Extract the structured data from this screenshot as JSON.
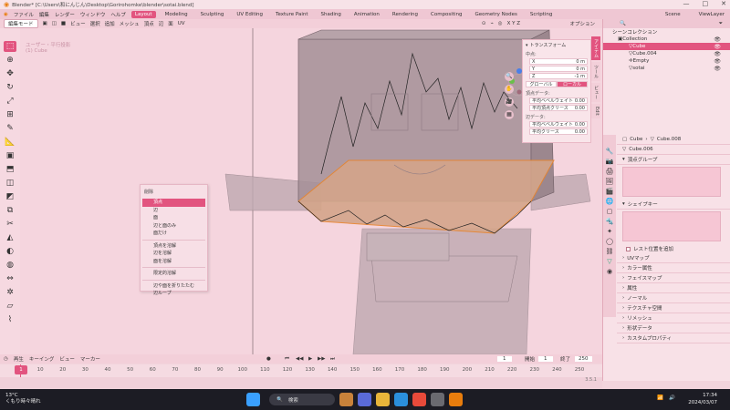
{
  "titlebar": {
    "title": "Blender* [C:\\Users\\和にんじん\\Desktop\\Gorirohomke\\blender\\sotai.blend]",
    "minimize": "—",
    "maximize": "□",
    "close": "✕"
  },
  "menubar": {
    "items": [
      "ファイル",
      "編集",
      "レンダー",
      "ウィンドウ",
      "ヘルプ"
    ],
    "workspaces": [
      "Layout",
      "Modeling",
      "Sculpting",
      "UV Editing",
      "Texture Paint",
      "Shading",
      "Animation",
      "Rendering",
      "Compositing",
      "Geometry Nodes",
      "Scripting"
    ],
    "scene": "Scene",
    "view_layer": "ViewLayer"
  },
  "viewport_header": {
    "mode": "編集モード",
    "menus": [
      "ビュー",
      "選択",
      "追加",
      "メッシュ",
      "頂点",
      "辺",
      "面",
      "UV"
    ],
    "axes": "X Y Z",
    "options": "オプション"
  },
  "viewport": {
    "view_label": "ユーザー・平行投影",
    "object_label": "(1) Cube"
  },
  "toolbar": {
    "tools": [
      "select-icon",
      "cursor-icon",
      "move-icon",
      "rotate-icon",
      "scale-icon",
      "transform-icon",
      "annotate-icon",
      "measure-icon",
      "add-cube-icon",
      "extrude-icon",
      "inset-icon",
      "bevel-icon",
      "loopcut-icon",
      "knife-icon",
      "polybuild-icon",
      "spin-icon",
      "smooth-icon",
      "edge-slide-icon",
      "shrink-icon",
      "shear-icon",
      "rip-icon"
    ]
  },
  "npanel": {
    "title": "トランスフォーム",
    "median_label": "中点:",
    "fields": [
      {
        "axis": "X",
        "value": "0 m"
      },
      {
        "axis": "Y",
        "value": "0 m"
      },
      {
        "axis": "Z",
        "value": "-1 m"
      }
    ],
    "global": "グローバル",
    "local": "ローカル",
    "vertex_data": "頂点データ:",
    "vertex_fields": [
      {
        "label": "平均ベベルウェイト",
        "value": "0.00"
      },
      {
        "label": "平均頂点クリース",
        "value": "0.00"
      }
    ],
    "edge_data": "辺データ:",
    "edge_fields": [
      {
        "label": "平均ベベルウェイト",
        "value": "0.00"
      },
      {
        "label": "平均クリース",
        "value": "0.00"
      }
    ]
  },
  "sidetabs": [
    "アイテム",
    "ツール",
    "ビュー",
    "Edit"
  ],
  "delete_menu": {
    "title": "削除",
    "items": [
      "頂点",
      "辺",
      "面",
      "辺と面のみ",
      "面だけ"
    ],
    "items2": [
      "頂点を溶解",
      "辺を溶解",
      "面を溶解"
    ],
    "items3": [
      "限定的溶解"
    ],
    "items4": [
      "辺や面を折りたたむ",
      "辺ループ"
    ]
  },
  "outliner": {
    "title": "シーンコレクション",
    "collection": "Collection",
    "objects": [
      "Cube",
      "Cube.004",
      "Empty",
      "sotai"
    ]
  },
  "properties": {
    "breadcrumb_obj": "Cube",
    "breadcrumb_mesh": "Cube.008",
    "mesh_name": "Cube.006",
    "sections": {
      "vertex_groups": "頂点グループ",
      "shape_keys": "シェイプキー",
      "rest_position": "レスト位置を追加",
      "uv_maps": "UVマップ",
      "color_attributes": "カラー属性",
      "face_maps": "フェイスマップ",
      "attributes": "属性",
      "normals": "ノーマル",
      "texture_space": "テクスチャ空間",
      "remesh": "リメッシュ",
      "geometry_data": "形状データ",
      "custom_props": "カスタムプロパティ"
    }
  },
  "timeline": {
    "menus": [
      "再生",
      "キーイング",
      "ビュー",
      "マーカー"
    ],
    "current_frame": "1",
    "start_label": "開始",
    "start": "1",
    "end_label": "終了",
    "end": "250",
    "ticks": [
      "10",
      "20",
      "30",
      "40",
      "50",
      "60",
      "70",
      "80",
      "90",
      "100",
      "110",
      "120",
      "130",
      "140",
      "150",
      "160",
      "170",
      "180",
      "190",
      "200",
      "210",
      "220",
      "230",
      "240",
      "250"
    ],
    "version": "3.5.1"
  },
  "taskbar": {
    "weather_temp": "13°C",
    "weather_desc": "くもり時々晴れ",
    "search": "検索",
    "time": "17:34",
    "date": "2024/03/07"
  }
}
